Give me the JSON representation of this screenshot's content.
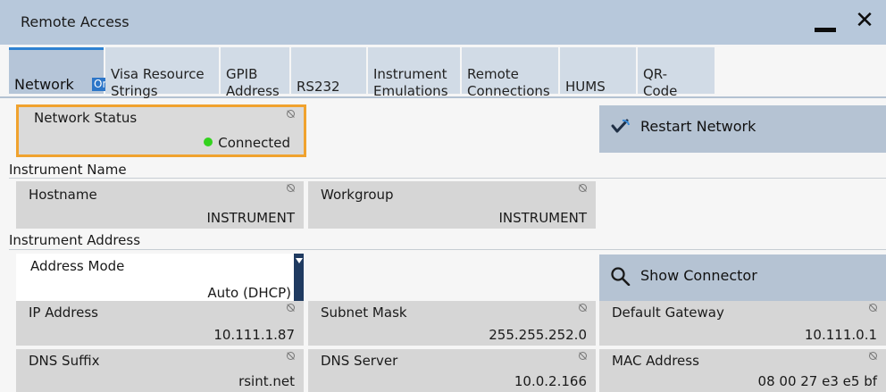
{
  "window": {
    "title": "Remote Access"
  },
  "tabs": [
    {
      "label": "Network"
    },
    {
      "label": "Visa Resource\nStrings"
    },
    {
      "label": "GPIB\nAddress"
    },
    {
      "label": "RS232"
    },
    {
      "label": "Instrument\nEmulations"
    },
    {
      "label": "Remote\nConnections"
    },
    {
      "label": "HUMS"
    },
    {
      "label": "QR-\nCode"
    }
  ],
  "network_badge": "On",
  "network_status": {
    "label": "Network Status",
    "value": "Connected",
    "indicator_color": "#33d21e"
  },
  "restart_button": {
    "label": "Restart Network",
    "icon": "restart-check-icon"
  },
  "instrument_name": {
    "heading": "Instrument Name",
    "hostname": {
      "label": "Hostname",
      "value": "INSTRUMENT"
    },
    "workgroup": {
      "label": "Workgroup",
      "value": "INSTRUMENT"
    }
  },
  "instrument_address": {
    "heading": "Instrument Address",
    "address_mode": {
      "label": "Address Mode",
      "value": "Auto (DHCP)"
    },
    "show_connector": {
      "label": "Show Connector",
      "icon": "search-icon"
    },
    "ip_address": {
      "label": "IP Address",
      "value": "10.111.1.87"
    },
    "subnet_mask": {
      "label": "Subnet Mask",
      "value": "255.255.252.0"
    },
    "default_gateway": {
      "label": "Default Gateway",
      "value": "10.111.0.1"
    },
    "dns_suffix": {
      "label": "DNS Suffix",
      "value": "rsint.net"
    },
    "dns_server": {
      "label": "DNS Server",
      "value": "10.0.2.166"
    },
    "mac_address": {
      "label": "MAC Address",
      "value": "08 00 27 e3 e5 bf"
    }
  },
  "colors": {
    "accent": "#2f82d1",
    "focus_border": "#f0a22e",
    "titlebar": "#b7c8db",
    "button": "#b5c3d3"
  }
}
